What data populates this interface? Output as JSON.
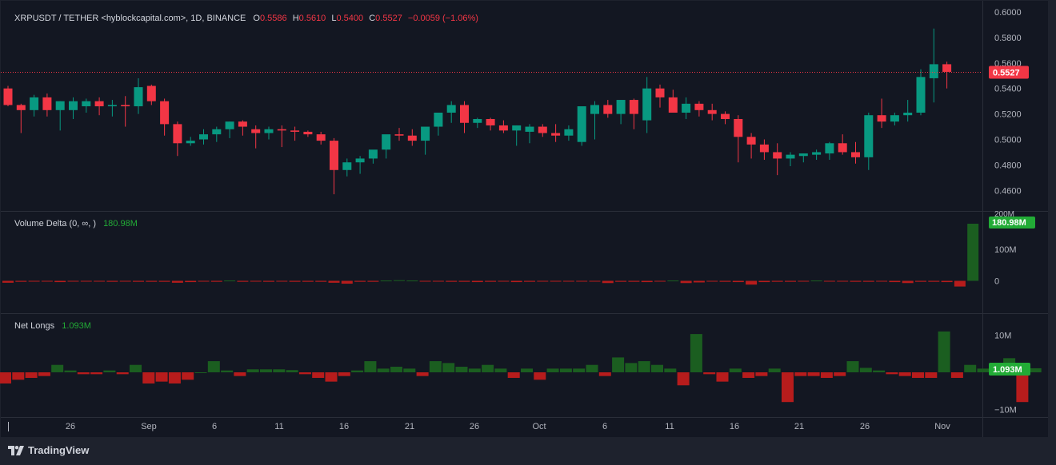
{
  "header": {
    "symbol": "XRPUSDT / TETHER <hyblockcapital.com>, 1D, BINANCE",
    "o_label": "O",
    "o": "0.5586",
    "h_label": "H",
    "h": "0.5610",
    "l_label": "L",
    "l": "0.5400",
    "c_label": "C",
    "c": "0.5527",
    "change": "−0.0059 (−1.06%)"
  },
  "indicators": {
    "volume_delta": {
      "label": "Volume Delta (0, ∞, )",
      "value": "180.98M"
    },
    "net_longs": {
      "label": "Net Longs",
      "value": "1.093M"
    }
  },
  "footer": {
    "brand": "TradingView"
  },
  "colors": {
    "up": "#089981",
    "down": "#f23645",
    "bar_up": "#1b5e20",
    "bar_down": "#b71c1c",
    "bg": "#131722",
    "frame": "#1e222d"
  },
  "chart_data": [
    {
      "type": "candlestick",
      "x_ticks": [
        "26",
        "Sep",
        "6",
        "11",
        "16",
        "21",
        "26",
        "Oct",
        "6",
        "11",
        "16",
        "21",
        "26",
        "Nov"
      ],
      "y_ticks": [
        "0.6000",
        "0.5800",
        "0.5600",
        "0.5400",
        "0.5200",
        "0.5000",
        "0.4800",
        "0.4600"
      ],
      "ylim": [
        0.4485,
        0.6045
      ],
      "last_price": "0.5527",
      "candles": [
        [
          0.54,
          0.542,
          0.526,
          0.527
        ],
        [
          0.527,
          0.528,
          0.505,
          0.523
        ],
        [
          0.523,
          0.535,
          0.518,
          0.533
        ],
        [
          0.533,
          0.536,
          0.518,
          0.523
        ],
        [
          0.523,
          0.53,
          0.507,
          0.53
        ],
        [
          0.523,
          0.533,
          0.516,
          0.53
        ],
        [
          0.526,
          0.532,
          0.521,
          0.53
        ],
        [
          0.53,
          0.533,
          0.519,
          0.526
        ],
        [
          0.526,
          0.531,
          0.518,
          0.527
        ],
        [
          0.527,
          0.534,
          0.51,
          0.526
        ],
        [
          0.526,
          0.548,
          0.52,
          0.541
        ],
        [
          0.542,
          0.543,
          0.527,
          0.53
        ],
        [
          0.53,
          0.532,
          0.503,
          0.512
        ],
        [
          0.512,
          0.514,
          0.487,
          0.497
        ],
        [
          0.497,
          0.502,
          0.495,
          0.499
        ],
        [
          0.5,
          0.508,
          0.496,
          0.504
        ],
        [
          0.504,
          0.51,
          0.498,
          0.508
        ],
        [
          0.508,
          0.514,
          0.501,
          0.514
        ],
        [
          0.514,
          0.515,
          0.503,
          0.51
        ],
        [
          0.508,
          0.511,
          0.493,
          0.505
        ],
        [
          0.505,
          0.51,
          0.5,
          0.508
        ],
        [
          0.508,
          0.511,
          0.494,
          0.507
        ],
        [
          0.507,
          0.51,
          0.499,
          0.506
        ],
        [
          0.506,
          0.507,
          0.502,
          0.504
        ],
        [
          0.504,
          0.506,
          0.496,
          0.499
        ],
        [
          0.499,
          0.501,
          0.457,
          0.476
        ],
        [
          0.476,
          0.485,
          0.471,
          0.482
        ],
        [
          0.482,
          0.487,
          0.473,
          0.485
        ],
        [
          0.485,
          0.49,
          0.481,
          0.492
        ],
        [
          0.492,
          0.499,
          0.485,
          0.504
        ],
        [
          0.504,
          0.509,
          0.499,
          0.503
        ],
        [
          0.503,
          0.508,
          0.495,
          0.499
        ],
        [
          0.499,
          0.508,
          0.488,
          0.51
        ],
        [
          0.51,
          0.516,
          0.503,
          0.521
        ],
        [
          0.521,
          0.53,
          0.513,
          0.527
        ],
        [
          0.527,
          0.53,
          0.505,
          0.513
        ],
        [
          0.513,
          0.517,
          0.509,
          0.516
        ],
        [
          0.516,
          0.517,
          0.507,
          0.511
        ],
        [
          0.511,
          0.515,
          0.505,
          0.507
        ],
        [
          0.507,
          0.511,
          0.495,
          0.511
        ],
        [
          0.506,
          0.512,
          0.497,
          0.51
        ],
        [
          0.51,
          0.512,
          0.502,
          0.505
        ],
        [
          0.505,
          0.512,
          0.498,
          0.503
        ],
        [
          0.503,
          0.511,
          0.499,
          0.508
        ],
        [
          0.498,
          0.524,
          0.495,
          0.526
        ],
        [
          0.52,
          0.53,
          0.5,
          0.527
        ],
        [
          0.527,
          0.531,
          0.517,
          0.52
        ],
        [
          0.52,
          0.53,
          0.512,
          0.531
        ],
        [
          0.531,
          0.532,
          0.508,
          0.52
        ],
        [
          0.515,
          0.549,
          0.505,
          0.54
        ],
        [
          0.54,
          0.543,
          0.525,
          0.533
        ],
        [
          0.533,
          0.539,
          0.522,
          0.521
        ],
        [
          0.521,
          0.533,
          0.516,
          0.528
        ],
        [
          0.528,
          0.53,
          0.518,
          0.523
        ],
        [
          0.523,
          0.528,
          0.515,
          0.52
        ],
        [
          0.52,
          0.522,
          0.512,
          0.516
        ],
        [
          0.516,
          0.519,
          0.482,
          0.502
        ],
        [
          0.502,
          0.505,
          0.485,
          0.496
        ],
        [
          0.496,
          0.5,
          0.484,
          0.49
        ],
        [
          0.49,
          0.497,
          0.472,
          0.485
        ],
        [
          0.485,
          0.49,
          0.479,
          0.488
        ],
        [
          0.487,
          0.489,
          0.482,
          0.489
        ],
        [
          0.488,
          0.492,
          0.484,
          0.49
        ],
        [
          0.489,
          0.498,
          0.484,
          0.497
        ],
        [
          0.497,
          0.504,
          0.488,
          0.49
        ],
        [
          0.49,
          0.498,
          0.481,
          0.486
        ],
        [
          0.486,
          0.521,
          0.476,
          0.519
        ],
        [
          0.519,
          0.532,
          0.509,
          0.514
        ],
        [
          0.514,
          0.521,
          0.511,
          0.519
        ],
        [
          0.519,
          0.531,
          0.514,
          0.521
        ],
        [
          0.521,
          0.555,
          0.519,
          0.549
        ],
        [
          0.548,
          0.587,
          0.529,
          0.559
        ],
        [
          0.559,
          0.561,
          0.54,
          0.553
        ]
      ]
    },
    {
      "type": "bar",
      "title": "Volume Delta (0, ∞, )",
      "y_ticks": [
        "200M",
        "100M",
        "0"
      ],
      "ylim": [
        -22,
        200
      ],
      "last_value": "180.98M",
      "values": [
        -6,
        -3,
        -2,
        -2,
        -4,
        -2,
        -2,
        -2,
        -3,
        -2,
        -3,
        -3,
        -3,
        -6,
        -4,
        -2,
        -3,
        1,
        -3,
        -2,
        -3,
        -2,
        -3,
        -3,
        -3,
        -6,
        -9,
        -3,
        -3,
        1,
        2,
        1,
        -2,
        -2,
        -3,
        -3,
        -4,
        -3,
        -2,
        -4,
        -3,
        -2,
        -2,
        -2,
        -2,
        -2,
        -7,
        -3,
        -3,
        -4,
        -2,
        1,
        -7,
        -5,
        -2,
        -3,
        -4,
        -12,
        -4,
        -3,
        -3,
        -2,
        1,
        -2,
        -2,
        -3,
        -3,
        -2,
        -4,
        -7,
        -3,
        -3,
        -4,
        -18,
        181
      ]
    },
    {
      "type": "bar",
      "title": "Net Longs",
      "y_ticks": [
        "10M",
        "0",
        "−10M"
      ],
      "ylim": [
        -12,
        13
      ],
      "last_value": "1.093M",
      "values": [
        -3,
        -2,
        -1.5,
        -1,
        2,
        0.5,
        -0.5,
        -0.5,
        0.5,
        -0.5,
        2,
        -3,
        -2.5,
        -3,
        -2,
        0,
        3,
        0.5,
        -1,
        0.8,
        0.8,
        0.8,
        0.6,
        -0.5,
        -1.5,
        -2.5,
        -1,
        0.5,
        3,
        1,
        1.5,
        1,
        -1,
        3,
        2.5,
        1.5,
        1,
        2,
        1,
        -1.5,
        1,
        -2,
        1,
        1,
        1,
        2,
        -1,
        4,
        2.5,
        3,
        2,
        1,
        -3.5,
        10.3,
        -0.5,
        -2.5,
        1,
        -1.5,
        -1,
        1,
        -8,
        -1,
        -1,
        -1.5,
        -1,
        3,
        1.2,
        0.5,
        -0.5,
        -1,
        -1.5,
        -1.5,
        11,
        -1.5,
        2,
        1,
        -0.5,
        3.8,
        -8,
        1.093
      ]
    }
  ]
}
